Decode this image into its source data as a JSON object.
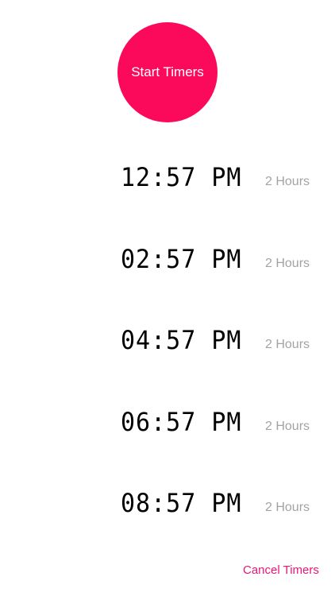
{
  "start_button": {
    "label": "Start Timers"
  },
  "timers": [
    {
      "time": "12:57 PM",
      "duration": "2 Hours"
    },
    {
      "time": "02:57 PM",
      "duration": "2 Hours"
    },
    {
      "time": "04:57 PM",
      "duration": "2 Hours"
    },
    {
      "time": "06:57 PM",
      "duration": "2 Hours"
    },
    {
      "time": "08:57 PM",
      "duration": "2 Hours"
    }
  ],
  "cancel_button": {
    "label": "Cancel Timers"
  },
  "colors": {
    "accent": "#fb0a5b",
    "cancel_text": "#e5187a",
    "duration_text": "#a3a3a3"
  }
}
